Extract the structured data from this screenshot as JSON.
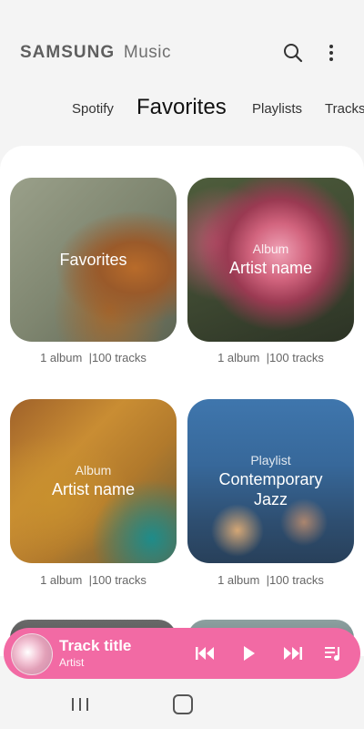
{
  "header": {
    "brand": "SAMSUNG",
    "app_name": "Music",
    "search_icon": "search-icon",
    "more_icon": "more-vertical-icon"
  },
  "tabs": [
    {
      "label": "Spotify",
      "active": false
    },
    {
      "label": "Favorites",
      "active": true
    },
    {
      "label": "Playlists",
      "active": false
    },
    {
      "label": "Tracks",
      "active": false
    }
  ],
  "cards": [
    {
      "subtitle": "",
      "title": "Favorites",
      "meta_albums": "1 album",
      "meta_tracks": "|100 tracks"
    },
    {
      "subtitle": "Album",
      "title": "Artist name",
      "meta_albums": "1 album",
      "meta_tracks": "|100 tracks"
    },
    {
      "subtitle": "Album",
      "title": "Artist name",
      "meta_albums": "1 album",
      "meta_tracks": "|100 tracks"
    },
    {
      "subtitle": "Playlist",
      "title": "Contemporary Jazz",
      "meta_albums": "1 album",
      "meta_tracks": "|100 tracks"
    }
  ],
  "mini_player": {
    "track_title": "Track title",
    "artist": "Artist",
    "color": "#f26aa4",
    "controls": [
      "previous-icon",
      "play-icon",
      "next-icon",
      "queue-icon"
    ]
  },
  "nav": {
    "recent_icon": "recent-apps-icon",
    "home_icon": "home-icon"
  }
}
